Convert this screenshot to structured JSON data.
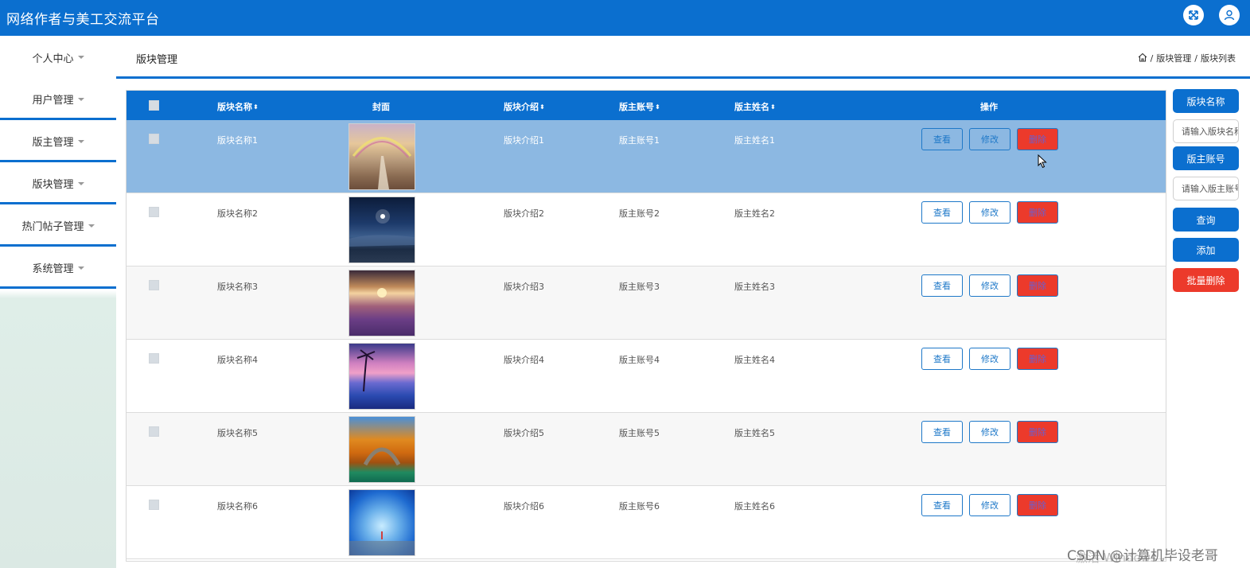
{
  "app": {
    "title": "网络作者与美工交流平台"
  },
  "topbar_icons": [
    "fullscreen-icon",
    "user-icon"
  ],
  "sidebar": {
    "items": [
      {
        "label": "个人中心"
      },
      {
        "label": "用户管理"
      },
      {
        "label": "版主管理"
      },
      {
        "label": "版块管理"
      },
      {
        "label": "热门帖子管理"
      },
      {
        "label": "系统管理"
      }
    ]
  },
  "page": {
    "title": "版块管理"
  },
  "breadcrumb": {
    "sep": "/",
    "items": [
      "版块管理",
      "版块列表"
    ]
  },
  "table": {
    "headers": {
      "name": "版块名称",
      "cover": "封面",
      "intro": "版块介绍",
      "account": "版主账号",
      "owner": "版主姓名",
      "actions": "操作"
    },
    "rows": [
      {
        "name": "版块名称1",
        "intro": "版块介绍1",
        "account": "版主账号1",
        "owner": "版主姓名1"
      },
      {
        "name": "版块名称2",
        "intro": "版块介绍2",
        "account": "版主账号2",
        "owner": "版主姓名2"
      },
      {
        "name": "版块名称3",
        "intro": "版块介绍3",
        "account": "版主账号3",
        "owner": "版主姓名3"
      },
      {
        "name": "版块名称4",
        "intro": "版块介绍4",
        "account": "版主账号4",
        "owner": "版主姓名4"
      },
      {
        "name": "版块名称5",
        "intro": "版块介绍5",
        "account": "版主账号5",
        "owner": "版主姓名5"
      },
      {
        "name": "版块名称6",
        "intro": "版块介绍6",
        "account": "版主账号6",
        "owner": "版主姓名6"
      }
    ],
    "actions": {
      "view": "查看",
      "edit": "修改",
      "delete": "删除"
    }
  },
  "search": {
    "name_label": "版块名称",
    "name_placeholder": "请输入版块名称",
    "account_label": "版主账号",
    "account_placeholder": "请输入版主账号",
    "query": "查询",
    "add": "添加",
    "batch_delete": "批量删除"
  },
  "watermark": {
    "windows": "激活 Windows",
    "csdn": "CSDN @计算机毕设老哥"
  },
  "colors": {
    "primary": "#0b6fcf",
    "danger": "#ec3a2b",
    "row_hover": "#8cb8e2"
  }
}
